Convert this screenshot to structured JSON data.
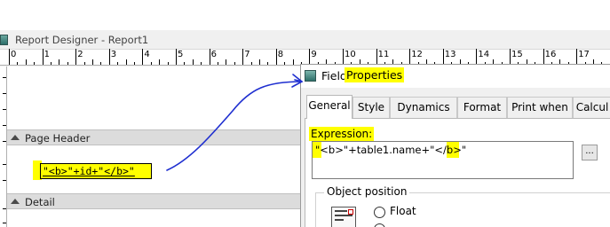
{
  "report_designer": {
    "title": "Report Designer - Report1",
    "ruler_numbers": [
      "0",
      "1",
      "2",
      "3",
      "4",
      "5",
      "6",
      "7",
      "8",
      "9",
      "10",
      "11",
      "12",
      "13",
      "14",
      "15",
      "16",
      "17"
    ],
    "bands": {
      "page_header": "Page Header",
      "detail": "Detail"
    },
    "field_expression": "\"<b>\"+id+\"</b>\""
  },
  "field_properties": {
    "title_prefix": "Field",
    "title_highlighted": "Properties",
    "tabs": [
      {
        "label": "General",
        "active": true
      },
      {
        "label": "Style",
        "active": false
      },
      {
        "label": "Dynamics",
        "active": false
      },
      {
        "label": "Format",
        "active": false
      },
      {
        "label": "Print when",
        "active": false
      },
      {
        "label": "Calcul",
        "active": false
      }
    ],
    "expression_label": "Expression:",
    "expression_value": "\"<b>\"+table1.name+\"</b>\"",
    "browse_label": "...",
    "object_position_label": "Object position",
    "position_options": [
      {
        "label": "Float",
        "selected": false
      }
    ]
  },
  "colors": {
    "highlight": "#ffff00",
    "annotation_ink": "#1f2fd0",
    "band": "#dcdcdc"
  },
  "icons": [
    "report-designer-app-icon",
    "field-properties-dialog-icon",
    "band-collapse-arrow-icon",
    "object-position-icon"
  ]
}
